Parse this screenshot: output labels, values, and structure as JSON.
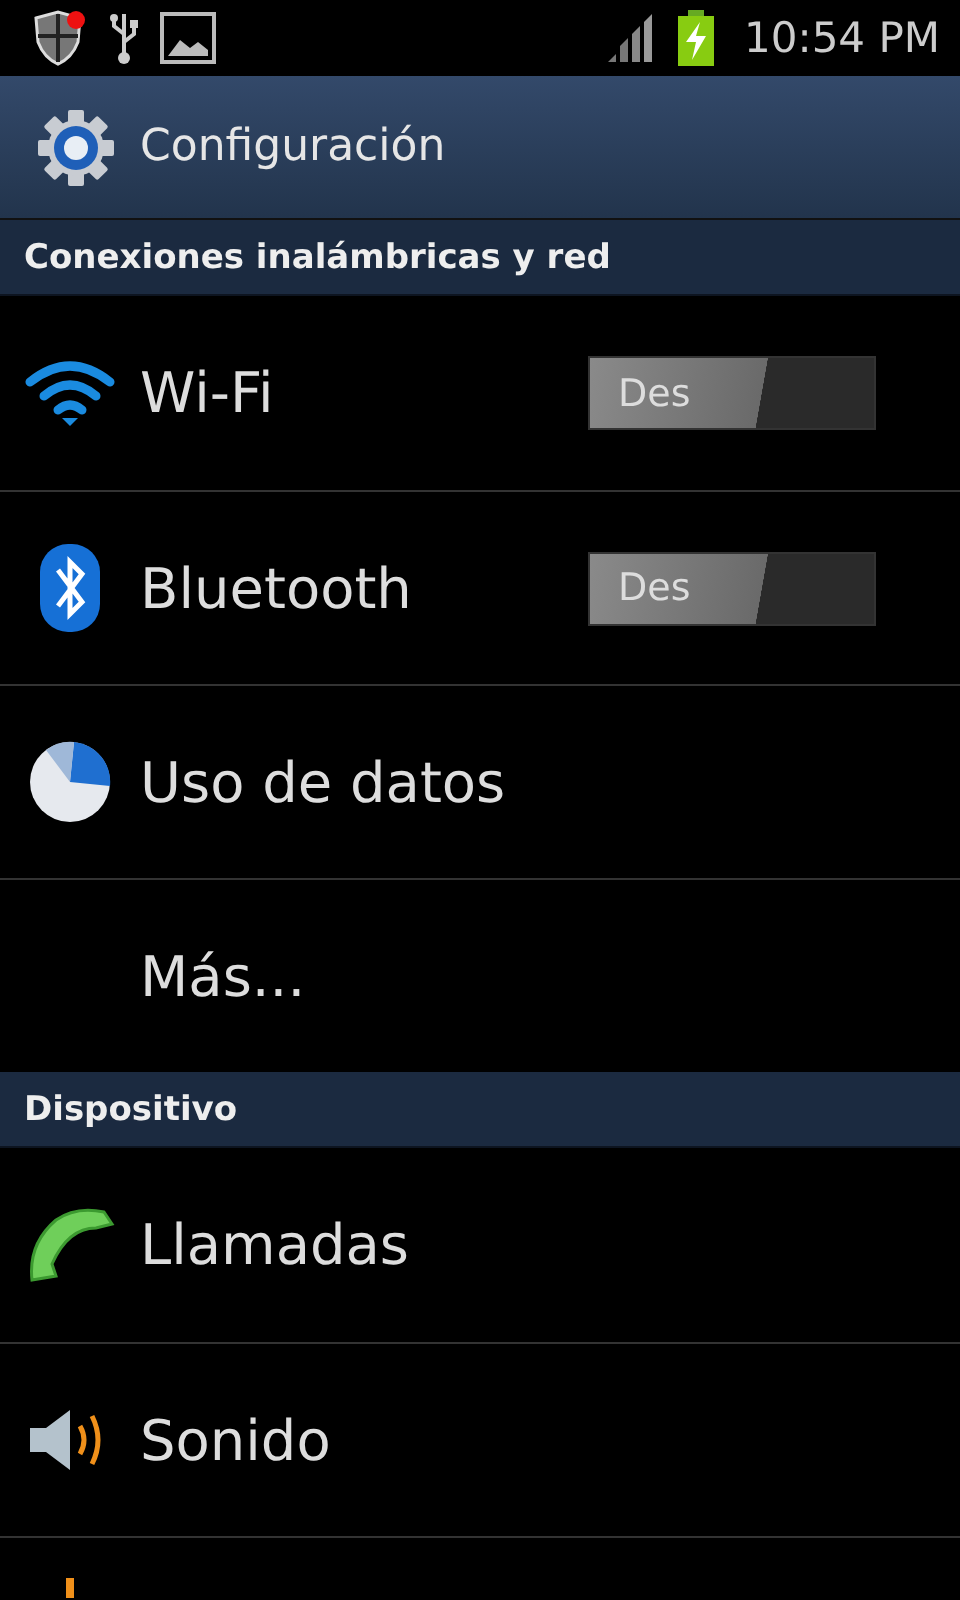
{
  "status_bar": {
    "time": "10:54 PM"
  },
  "title_bar": {
    "title": "Configuración"
  },
  "sections": [
    {
      "title": "Conexiones inalámbricas y red",
      "items": [
        {
          "label": "Wi-Fi",
          "toggle": {
            "text": "Des",
            "on": false
          }
        },
        {
          "label": "Bluetooth",
          "toggle": {
            "text": "Des",
            "on": false
          }
        },
        {
          "label": "Uso de datos"
        },
        {
          "label": "Más..."
        }
      ]
    },
    {
      "title": "Dispositivo",
      "items": [
        {
          "label": "Llamadas"
        },
        {
          "label": "Sonido"
        },
        {
          "kind": "cut"
        }
      ]
    }
  ]
}
